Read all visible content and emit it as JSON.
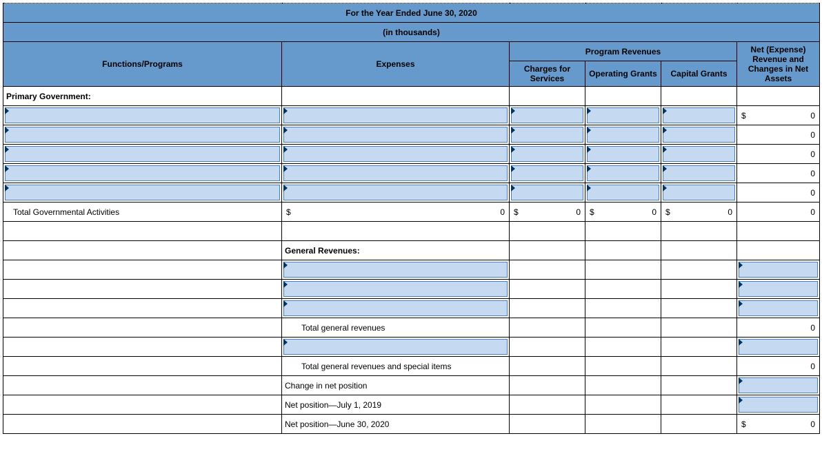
{
  "title": "For the Year Ended June 30, 2020",
  "subtitle": "(in thousands)",
  "headers": {
    "programRevenues": "Program Revenues",
    "netExpense": "Net (Expense) Revenue and Changes in Net Assets",
    "functions": "Functions/Programs",
    "expenses": "Expenses",
    "charges": "Charges for Services",
    "operating": "Operating Grants",
    "capital": "Capital Grants"
  },
  "rows": {
    "primaryGov": "Primary Government:",
    "totalGov": "Total Governmental Activities",
    "generalRev": "General Revenues:",
    "totalGenRev": "Total general revenues",
    "totalGenRevSpecial": "Total general revenues and special items",
    "changeNet": "Change in net position",
    "netPosStart": "Net position—July 1, 2019",
    "netPosEnd": "Net position—June 30, 2020"
  },
  "vals": {
    "dollar": "$",
    "zero": "0",
    "dollarZero": "$              0"
  },
  "chart_data": {
    "type": "table",
    "title": "Statement of Activities — For the Year Ended June 30, 2020 (in thousands)",
    "columns": [
      "Functions/Programs",
      "Expenses",
      "Charges for Services",
      "Operating Grants",
      "Capital Grants",
      "Net (Expense) Revenue and Changes in Net Assets"
    ],
    "rows": [
      [
        "Primary Government:",
        "",
        "",
        "",
        "",
        ""
      ],
      [
        "",
        "",
        "",
        "",
        "",
        0
      ],
      [
        "",
        "",
        "",
        "",
        "",
        0
      ],
      [
        "",
        "",
        "",
        "",
        "",
        0
      ],
      [
        "",
        "",
        "",
        "",
        "",
        0
      ],
      [
        "",
        "",
        "",
        "",
        "",
        0
      ],
      [
        "Total Governmental Activities",
        0,
        0,
        0,
        0,
        0
      ],
      [
        "",
        "General Revenues:",
        "",
        "",
        "",
        ""
      ],
      [
        "",
        "",
        "",
        "",
        "",
        ""
      ],
      [
        "",
        "",
        "",
        "",
        "",
        ""
      ],
      [
        "",
        "",
        "",
        "",
        "",
        ""
      ],
      [
        "",
        "Total general revenues",
        "",
        "",
        "",
        0
      ],
      [
        "",
        "",
        "",
        "",
        "",
        ""
      ],
      [
        "",
        "Total general revenues and special items",
        "",
        "",
        "",
        0
      ],
      [
        "",
        "Change in net position",
        "",
        "",
        "",
        ""
      ],
      [
        "",
        "Net position—July 1, 2019",
        "",
        "",
        "",
        ""
      ],
      [
        "",
        "Net position—June 30, 2020",
        "",
        "",
        "",
        0
      ]
    ]
  }
}
